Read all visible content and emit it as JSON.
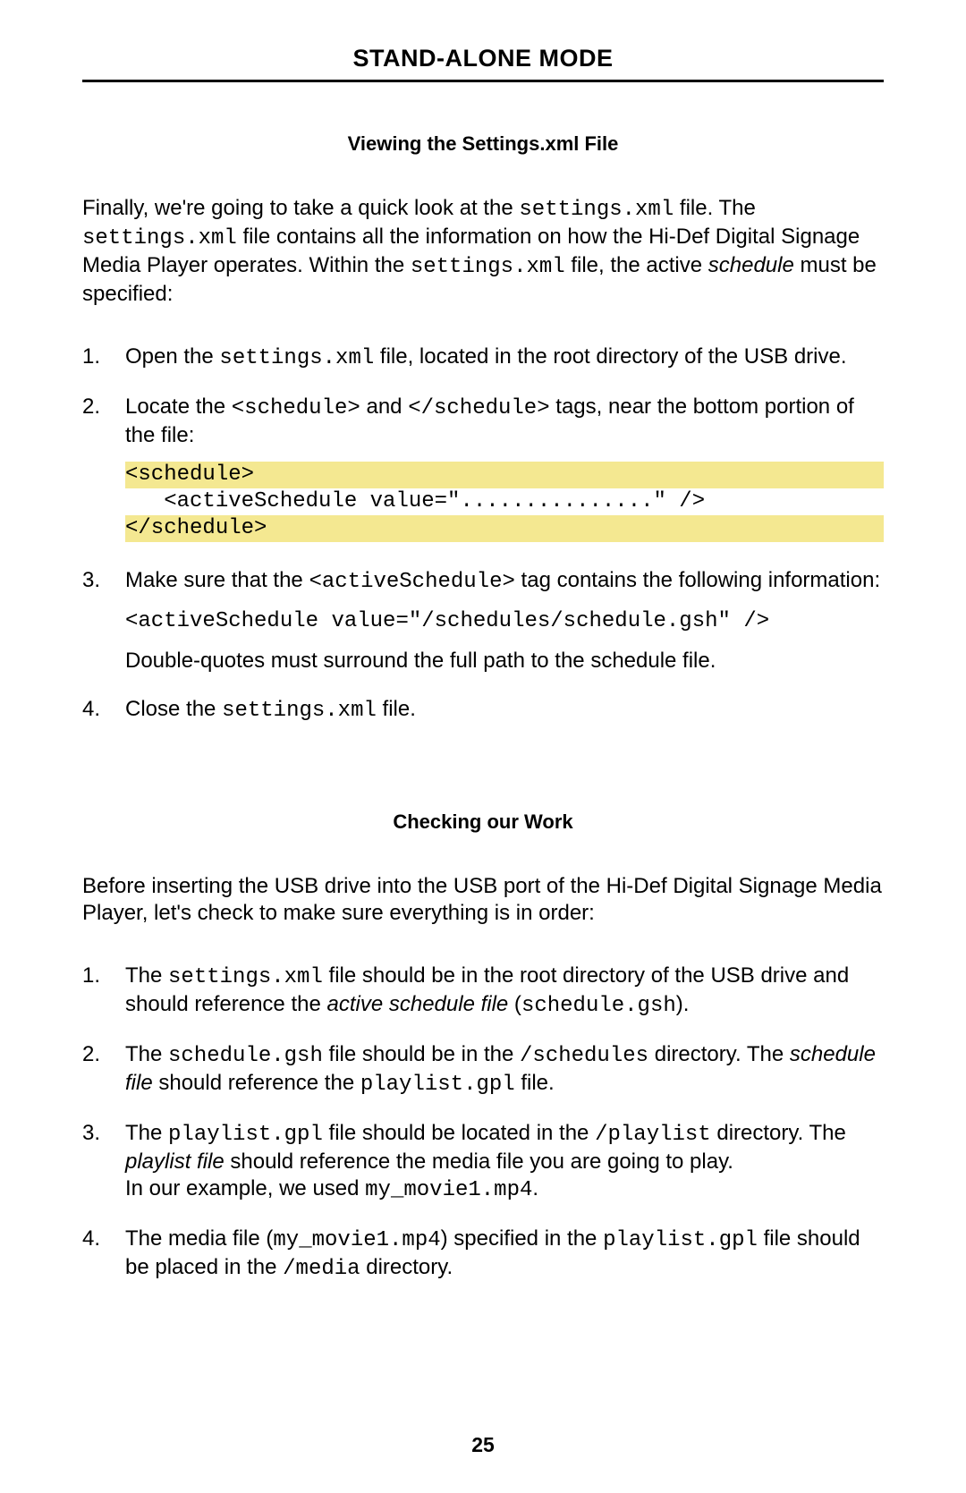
{
  "header": {
    "title": "STAND-ALONE MODE"
  },
  "section1": {
    "heading": "Viewing the Settings.xml File",
    "intro_a": "Finally, we're going to take a quick look at the ",
    "intro_code1": "settings.xml",
    "intro_b": " file.  The ",
    "intro_code2": "settings.xml",
    "intro_c": " file contains all the information on how the Hi-Def Digital Signage Media Player operates.  Within the ",
    "intro_code3": "settings.xml",
    "intro_d": " file, the active ",
    "intro_ital": "schedule",
    "intro_e": " must be specified:",
    "items": [
      {
        "n": "1.",
        "t1": "Open the ",
        "c1": "settings.xml",
        "t2": " file, located in the root directory of the USB drive."
      },
      {
        "n": "2.",
        "t1": "Locate the ",
        "c1": "<schedule>",
        "t2": " and ",
        "c2": "</schedule>",
        "t3": " tags, near the bottom portion of the file:",
        "code": {
          "l1": "<schedule>",
          "l2": "   <activeSchedule value=\"...............\" />",
          "l3": "</schedule>"
        }
      },
      {
        "n": "3.",
        "t1": "Make sure that the ",
        "c1": "<activeSchedule>",
        "t2": " tag contains the following information:",
        "code_plain": "<activeSchedule value=\"/schedules/schedule.gsh\" />",
        "t3": "Double-quotes must surround the full path to the schedule file."
      },
      {
        "n": "4.",
        "t1": "Close the ",
        "c1": "settings.xml",
        "t2": " file."
      }
    ]
  },
  "section2": {
    "heading": "Checking our Work",
    "intro": "Before inserting the USB drive into the USB port of the Hi-Def Digital Signage Media Player, let's check to make sure everything is in order:",
    "items": [
      {
        "n": "1.",
        "t1": "The ",
        "c1": "settings.xml",
        "t2": " file should be in the root directory of the USB drive and should reference the ",
        "i1": "active schedule file",
        "t3": " (",
        "c2": "schedule.gsh",
        "t4": ")."
      },
      {
        "n": "2.",
        "t1": "The ",
        "c1": "schedule.gsh",
        "t2": " file should be in the ",
        "c2": "/schedules",
        "t3": " directory.  The ",
        "i1": "schedule file",
        "t4": " should reference the ",
        "c3": "playlist.gpl",
        "t5": "  file."
      },
      {
        "n": "3.",
        "t1": "The ",
        "c1": "playlist.gpl",
        "t2": " file should be located in the ",
        "c2": "/playlist",
        "t3": " directory.  The ",
        "i1": "playlist file",
        "t4": " should reference the media file you are going to play.",
        "t5": "In our example, we used ",
        "c3": "my_movie1.mp4",
        "t6": "."
      },
      {
        "n": "4.",
        "t1": "The media file (",
        "c1": "my_movie1.mp4",
        "t2": ") specified in the ",
        "c2": "playlist.gpl",
        "t3": " file should be placed in the ",
        "c3": "/media",
        "t4": " directory."
      }
    ]
  },
  "page_number": "25"
}
